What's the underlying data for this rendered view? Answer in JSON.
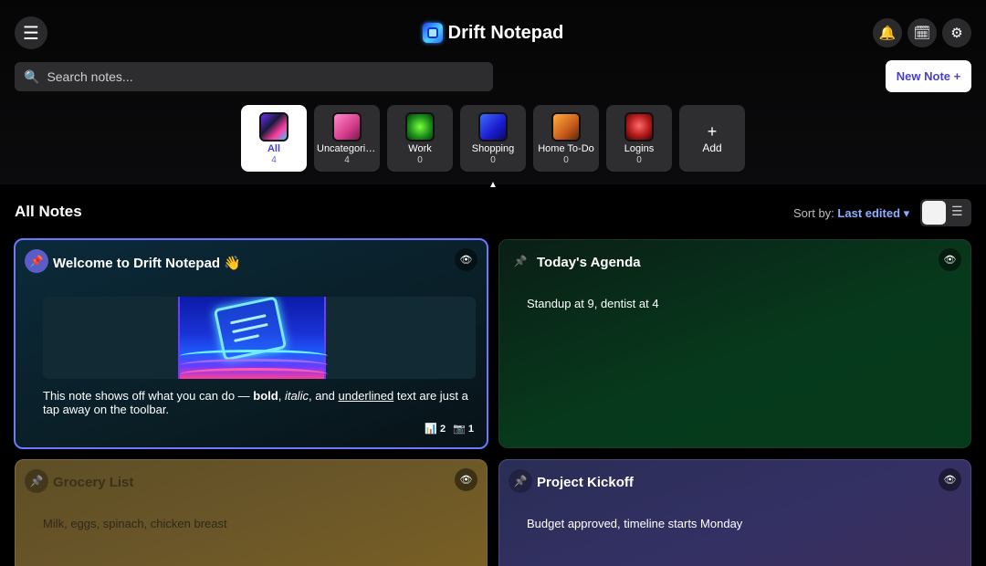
{
  "header": {
    "title": "Drift Notepad",
    "menu_icon": "☰",
    "bell_icon": "🔔",
    "calendar_icon": "🗓",
    "gear_icon": "⚙"
  },
  "search": {
    "icon": "🔍",
    "placeholder": "Search notes..."
  },
  "new_note_label": "New Note +",
  "categories": [
    {
      "name": "All",
      "count": "4",
      "active": true
    },
    {
      "name": "Uncategorized",
      "count": "4"
    },
    {
      "name": "Work",
      "count": "0"
    },
    {
      "name": "Shopping",
      "count": "0"
    },
    {
      "name": "Home To-Do",
      "count": "0"
    },
    {
      "name": "Logins",
      "count": "0"
    }
  ],
  "add_category": {
    "plus": "+",
    "label": "Add"
  },
  "collapse_caret": "▲",
  "section": {
    "title": "All Notes",
    "sort_prefix": "Sort by:",
    "sort_value": "Last edited ▾",
    "list_icon": "☰"
  },
  "notes": [
    {
      "title": "Welcome to Drift Notepad 👋",
      "pinned": true,
      "pin_icon": "📌",
      "eye_icon": "👁",
      "text_before": "This note shows off what you can do — ",
      "bold": "bold",
      "sep1": ", ",
      "italic": "italic",
      "sep2": ", and ",
      "underlined": "underlined",
      "text_after": " text are just a tap away on the toolbar.",
      "chart_icon": "📊",
      "chart_count": "2",
      "camera_icon": "📷",
      "camera_count": "1"
    },
    {
      "title": "Today's Agenda",
      "pin_icon": "📌",
      "eye_icon": "👁",
      "text": "Standup at 9, dentist at 4"
    },
    {
      "title": "Grocery List",
      "pin_icon": "📌",
      "eye_icon": "👁",
      "text": "Milk, eggs, spinach, chicken breast"
    },
    {
      "title": "Project Kickoff",
      "pin_icon": "📌",
      "eye_icon": "👁",
      "text": "Budget approved, timeline starts Monday"
    }
  ],
  "colors": {
    "accent": "#4a40c8",
    "selected_border": "#6b78ff",
    "sort_link": "#8ab0ff"
  }
}
